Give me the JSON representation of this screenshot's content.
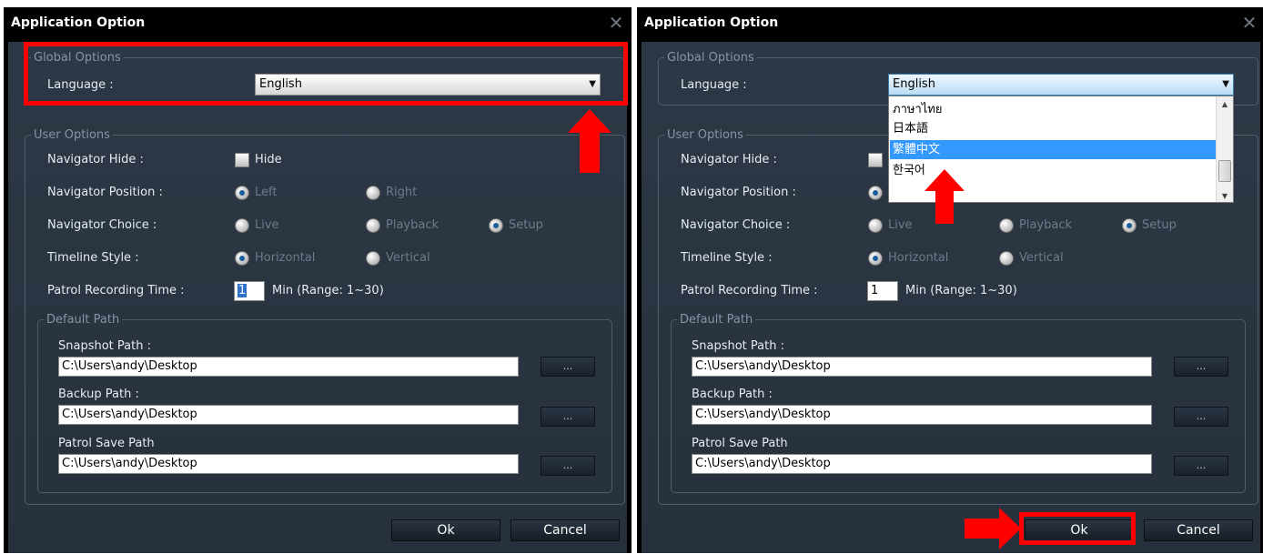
{
  "dialog": {
    "title": "Application Option",
    "close_icon": "close-icon"
  },
  "global_options": {
    "legend": "Global Options",
    "language_label": "Language :",
    "language_value": "English"
  },
  "language_dropdown": {
    "items": [
      "ภาษาไทย",
      "日本語",
      "繁體中文",
      "한국어"
    ],
    "highlighted_index": 2
  },
  "user_options": {
    "legend": "User Options",
    "navigator_hide_label": "Navigator Hide :",
    "hide_checkbox_label": "Hide",
    "hide_checked": false,
    "navigator_position_label": "Navigator Position :",
    "position_options": [
      "Left",
      "Right"
    ],
    "position_selected": "Left",
    "navigator_choice_label": "Navigator Choice :",
    "choice_options": [
      "Live",
      "Playback",
      "Setup"
    ],
    "choice_selected": "Setup",
    "timeline_style_label": "Timeline Style :",
    "timeline_options": [
      "Horizontal",
      "Vertical"
    ],
    "timeline_selected": "Horizontal",
    "patrol_time_label": "Patrol Recording Time :",
    "patrol_time_value": "1",
    "patrol_time_unit": "Min (Range: 1~30)"
  },
  "default_path": {
    "legend": "Default Path",
    "snapshot_label": "Snapshot Path :",
    "snapshot_value": "C:\\Users\\andy\\Desktop",
    "backup_label": "Backup Path :",
    "backup_value": "C:\\Users\\andy\\Desktop",
    "patrol_save_label": "Patrol Save Path",
    "patrol_save_value": "C:\\Users\\andy\\Desktop",
    "browse_label": "..."
  },
  "buttons": {
    "ok": "Ok",
    "cancel": "Cancel"
  },
  "colors": {
    "annotation_red": "#ff0000",
    "dialog_bg": "#2a3441",
    "selection_blue": "#3399ff"
  }
}
